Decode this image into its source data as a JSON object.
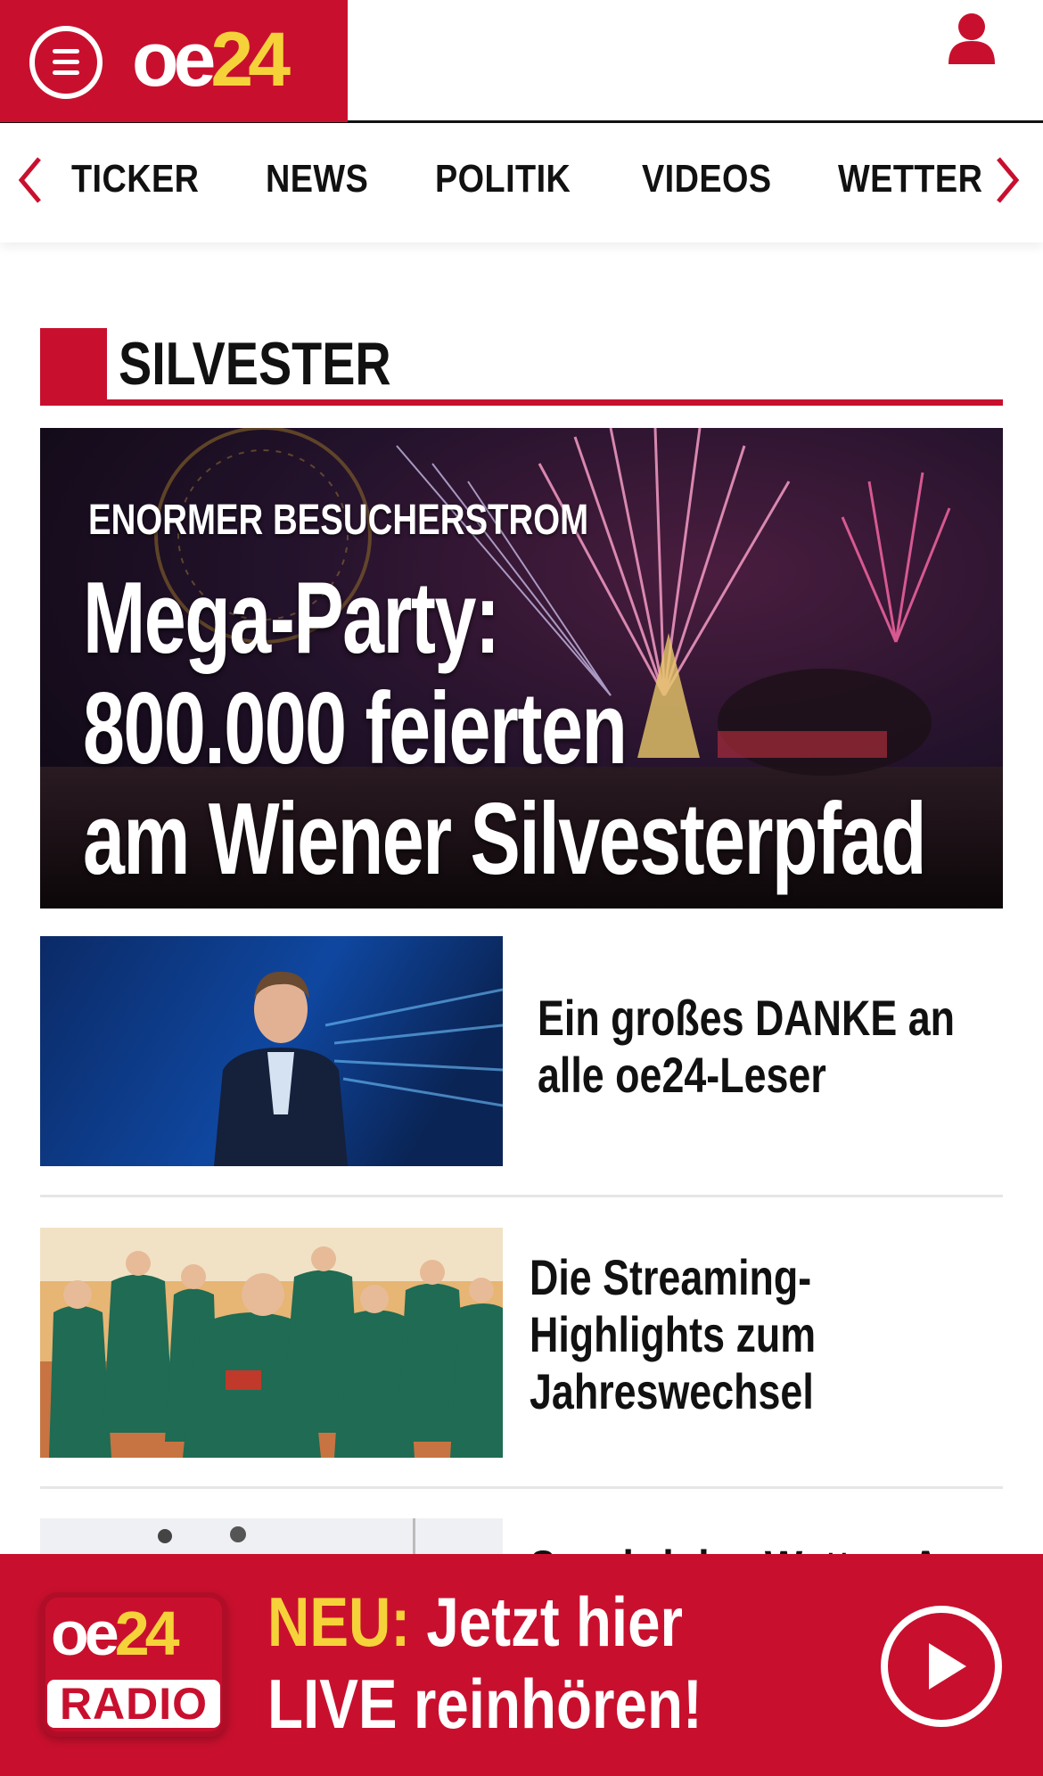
{
  "header": {
    "logo_oe": "oe",
    "logo_num": "24",
    "menu_icon": "hamburger-menu-icon",
    "user_icon": "user-icon"
  },
  "nav": {
    "items": [
      "TICKER",
      "NEWS",
      "POLITIK",
      "VIDEOS",
      "WETTER"
    ]
  },
  "section": {
    "title": "SILVESTER"
  },
  "hero": {
    "kicker": "ENORMER BESUCHERSTROM",
    "title_lines": [
      "Mega-Party:",
      "800.000 feierten",
      "am Wiener Silvesterpfad"
    ]
  },
  "articles": [
    {
      "headline_lines": [
        "Ein großes DANKE an",
        "alle oe24-Leser"
      ]
    },
    {
      "headline_lines": [
        "Die Streaming-",
        "Highlights zum",
        "Jahreswechsel"
      ]
    },
    {
      "headline_lines": [
        "So wird das Wetter: A"
      ]
    }
  ],
  "radio": {
    "logo_oe": "oe",
    "logo_num": "24",
    "logo_label": "RADIO",
    "neu": "NEU:",
    "line1": " Jetzt hier",
    "line2": "LIVE reinhören!",
    "play_icon": "play-icon"
  },
  "colors": {
    "brand_red": "#c8102e",
    "brand_yellow": "#f6d23a"
  }
}
